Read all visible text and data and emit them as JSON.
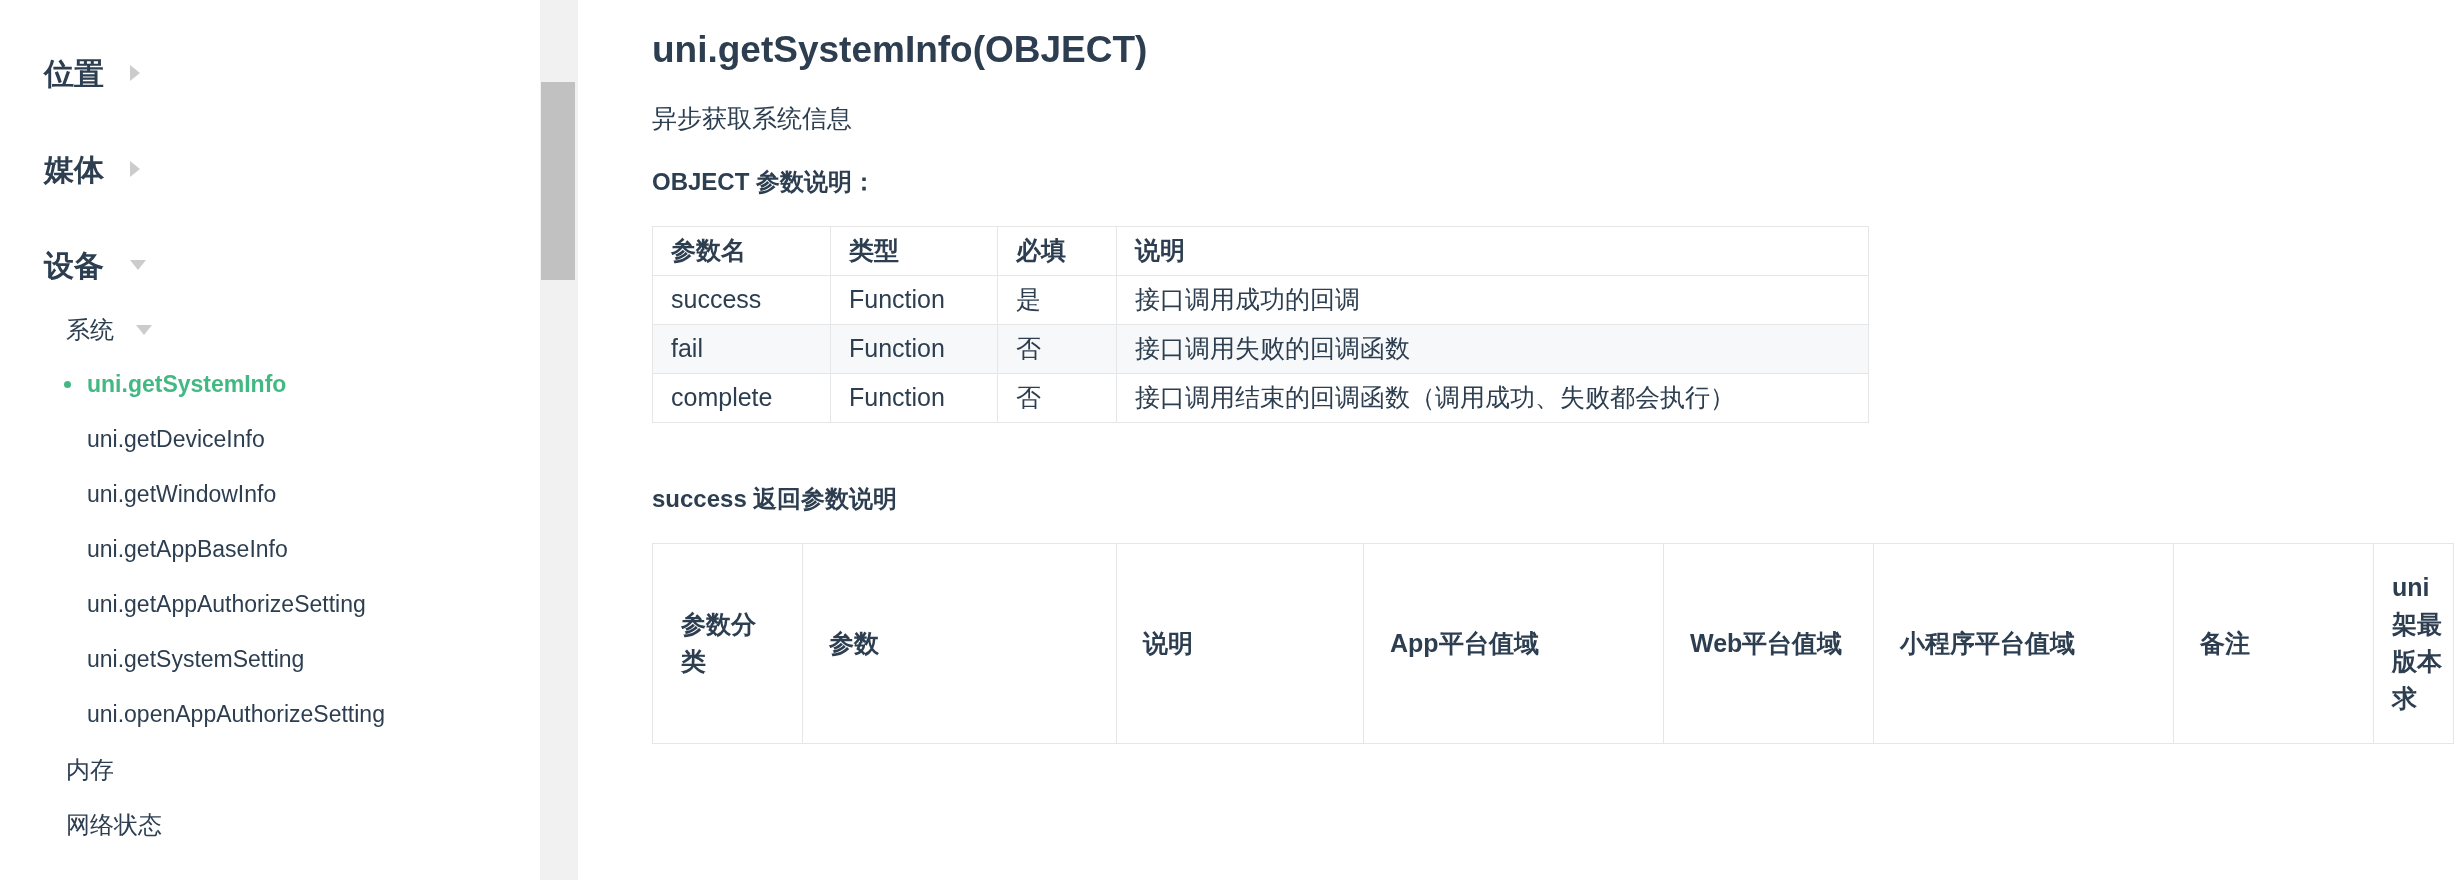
{
  "sidebar": {
    "items": [
      {
        "label": "位置",
        "expanded": false
      },
      {
        "label": "媒体",
        "expanded": false
      },
      {
        "label": "设备",
        "expanded": true,
        "children": [
          {
            "label": "系统",
            "expanded": true,
            "children": [
              {
                "label": "uni.getSystemInfo",
                "selected": true
              },
              {
                "label": "uni.getDeviceInfo",
                "selected": false
              },
              {
                "label": "uni.getWindowInfo",
                "selected": false
              },
              {
                "label": "uni.getAppBaseInfo",
                "selected": false
              },
              {
                "label": "uni.getAppAuthorizeSetting",
                "selected": false
              },
              {
                "label": "uni.getSystemSetting",
                "selected": false
              },
              {
                "label": "uni.openAppAuthorizeSetting",
                "selected": false
              }
            ]
          },
          {
            "label": "内存"
          },
          {
            "label": "网络状态"
          }
        ]
      }
    ]
  },
  "content": {
    "title": "uni.getSystemInfo(OBJECT)",
    "description": "异步获取系统信息",
    "object_heading": "OBJECT 参数说明：",
    "object_table": {
      "columns": [
        "参数名",
        "类型",
        "必填",
        "说明"
      ],
      "rows": [
        [
          "success",
          "Function",
          "是",
          "接口调用成功的回调"
        ],
        [
          "fail",
          "Function",
          "否",
          "接口调用失败的回调函数"
        ],
        [
          "complete",
          "Function",
          "否",
          "接口调用结束的回调函数（调用成功、失败都会执行）"
        ]
      ]
    },
    "success_heading": "success 返回参数说明",
    "success_table": {
      "columns": [
        "参数分类",
        "参数",
        "说明",
        "App平台值域",
        "Web平台值域",
        "小程序平台值域",
        "备注",
        "uni架最版本求"
      ]
    }
  }
}
